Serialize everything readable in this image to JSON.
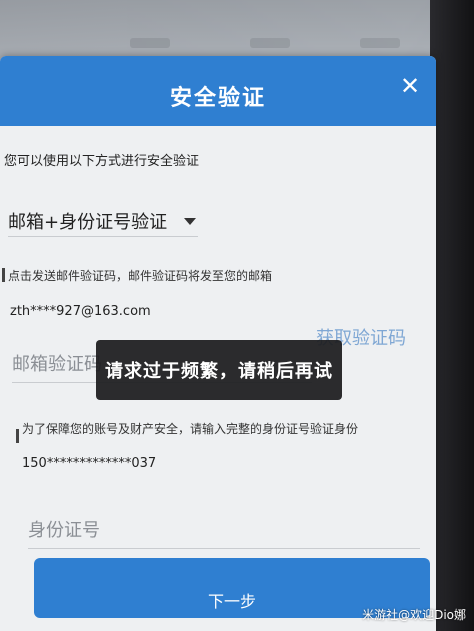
{
  "dialog": {
    "title": "安全验证",
    "close_icon": "close-icon",
    "intro": "您可以使用以下方式进行安全验证",
    "method": "邮箱+身份证号验证",
    "email_note": "点击发送邮件验证码，邮件验证码将发至您的邮箱",
    "email_masked": "zth****927@163.com",
    "email_code_placeholder": "邮箱验证码",
    "send_code_label": "获取验证码",
    "id_note": "为了保障您的账号及财产安全，请输入完整的身份证号验证身份",
    "phone_masked": "150*************037",
    "id_placeholder": "身份证号",
    "next_label": "下一步"
  },
  "toast": {
    "message": "请求过于频繁，请稍后再试"
  },
  "watermark": "米游社@欢迎Dio娜",
  "colors": {
    "primary": "#2f7fd1",
    "toast_bg": "#1c1c1e"
  }
}
